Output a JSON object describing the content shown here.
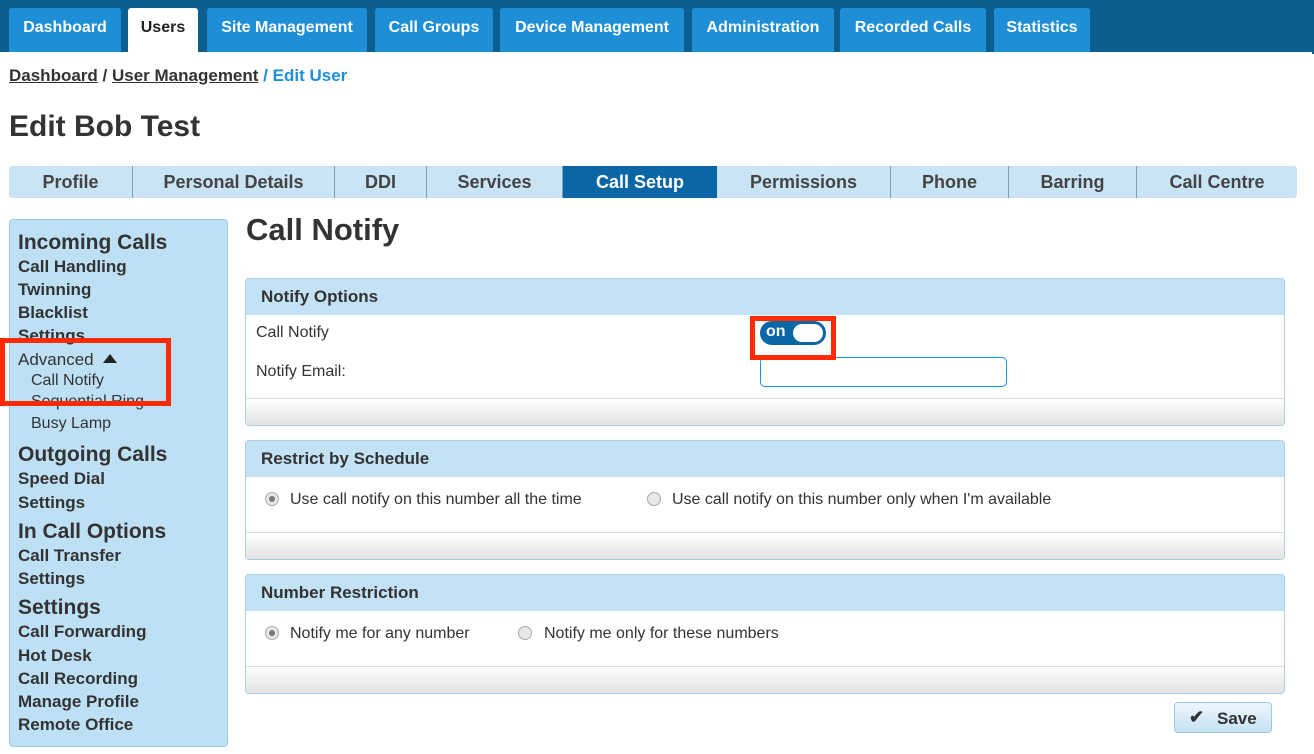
{
  "nav": {
    "tabs": [
      {
        "label": "Dashboard"
      },
      {
        "label": "Users"
      },
      {
        "label": "Site Management"
      },
      {
        "label": "Call Groups"
      },
      {
        "label": "Device Management"
      },
      {
        "label": "Administration"
      },
      {
        "label": "Recorded Calls"
      },
      {
        "label": "Statistics"
      }
    ],
    "active": "Users"
  },
  "breadcrumb": {
    "items": [
      "Dashboard",
      "User Management",
      "Edit User"
    ],
    "separator": "/"
  },
  "page": {
    "title": "Edit Bob Test"
  },
  "subtabs": {
    "items": [
      {
        "label": "Profile"
      },
      {
        "label": "Personal Details"
      },
      {
        "label": "DDI"
      },
      {
        "label": "Services"
      },
      {
        "label": "Call Setup"
      },
      {
        "label": "Permissions"
      },
      {
        "label": "Phone"
      },
      {
        "label": "Barring"
      },
      {
        "label": "Call Centre"
      }
    ],
    "active": "Call Setup"
  },
  "sidebar": {
    "incoming_heading": "Incoming Calls",
    "call_handling": "Call Handling",
    "twinning": "Twinning",
    "blacklist": "Blacklist",
    "settings1": "Settings",
    "advanced": "Advanced",
    "advanced_icon": "triangle-up-icon",
    "call_notify": "Call Notify",
    "sequential_ring": "Sequential Ring",
    "busy_lamp": "Busy Lamp",
    "outgoing_heading": "Outgoing Calls",
    "speed_dial": "Speed Dial",
    "settings2": "Settings",
    "incall_heading": "In Call Options",
    "call_transfer": "Call Transfer",
    "settings3": "Settings",
    "settings_heading": "Settings",
    "call_forwarding": "Call Forwarding",
    "hot_desk": "Hot Desk",
    "call_recording": "Call Recording",
    "manage_profile": "Manage Profile",
    "remote_office": "Remote Office"
  },
  "main": {
    "heading": "Call Notify",
    "notify_options": {
      "title": "Notify Options",
      "call_notify_label": "Call Notify",
      "toggle_label": "on",
      "toggle_state": true,
      "email_label": "Notify Email:",
      "email_value": ""
    },
    "schedule": {
      "title": "Restrict by Schedule",
      "option1": "Use call notify on this number all the time",
      "option2": "Use call notify on this number only when I'm available",
      "selected": 1
    },
    "number_restriction": {
      "title": "Number Restriction",
      "option1": "Notify me for any number",
      "option2": "Notify me only for these numbers",
      "selected": 1
    },
    "save_label": "Save",
    "save_icon": "check-icon"
  },
  "colors": {
    "nav_bg": "#0b5e8e",
    "nav_tab": "#1e8fd6",
    "subtab_active": "#0b66a6",
    "panel_header": "#c3e2f5",
    "sidebar_bg": "#bee0f5",
    "highlight": "#ff2a00"
  }
}
